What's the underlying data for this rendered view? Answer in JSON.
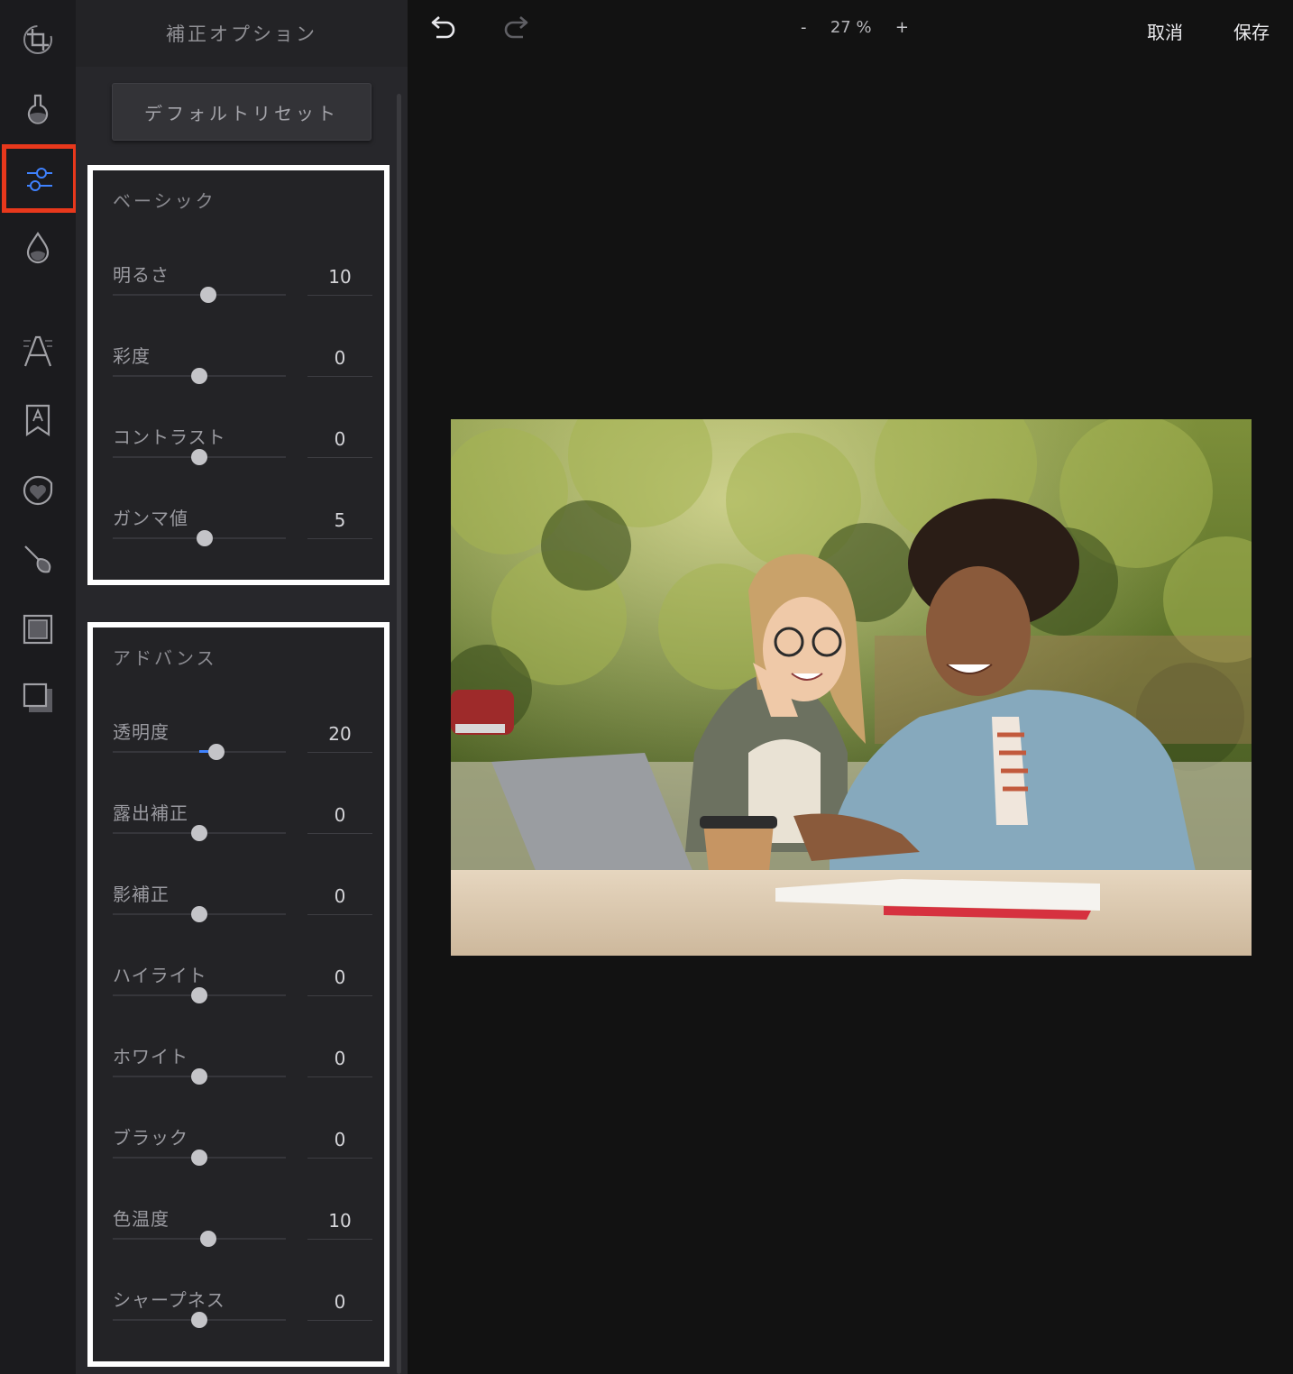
{
  "rail": {
    "tools": [
      {
        "name": "crop-icon",
        "active": false
      },
      {
        "name": "filter-icon",
        "active": false
      },
      {
        "name": "adjust-sliders-icon",
        "active": true
      },
      {
        "name": "color-drop-icon",
        "active": false
      },
      {
        "name": "text-icon",
        "active": false
      },
      {
        "name": "sticker-tag-icon",
        "active": false
      },
      {
        "name": "heart-sticker-icon",
        "active": false
      },
      {
        "name": "brush-icon",
        "active": false
      },
      {
        "name": "frame-icon",
        "active": false
      },
      {
        "name": "shadow-square-icon",
        "active": false
      }
    ]
  },
  "panel": {
    "title": "補正オプション",
    "reset_label": "デフォルトリセット",
    "basic": {
      "title": "ベーシック",
      "rows": [
        {
          "label": "明るさ",
          "value": "10",
          "level": 0.55
        },
        {
          "label": "彩度",
          "value": "0",
          "level": 0.5
        },
        {
          "label": "コントラスト",
          "value": "0",
          "level": 0.5
        },
        {
          "label": "ガンマ値",
          "value": "5",
          "level": 0.53
        }
      ]
    },
    "advanced": {
      "title": "アドバンス",
      "rows": [
        {
          "label": "透明度",
          "value": "20",
          "level": 0.6,
          "fill_from": 0.5
        },
        {
          "label": "露出補正",
          "value": "0",
          "level": 0.5
        },
        {
          "label": "影補正",
          "value": "0",
          "level": 0.5
        },
        {
          "label": "ハイライト",
          "value": "0",
          "level": 0.5
        },
        {
          "label": "ホワイト",
          "value": "0",
          "level": 0.5
        },
        {
          "label": "ブラック",
          "value": "0",
          "level": 0.5
        },
        {
          "label": "色温度",
          "value": "10",
          "level": 0.55
        },
        {
          "label": "シャープネス",
          "value": "0",
          "level": 0.5
        }
      ]
    }
  },
  "topbar": {
    "zoom_minus": "-",
    "zoom_value": "27 %",
    "zoom_plus": "+",
    "cancel_label": "取消",
    "save_label": "保存"
  },
  "colors": {
    "accent": "#3f82ff",
    "active_outline": "#e8381c"
  }
}
